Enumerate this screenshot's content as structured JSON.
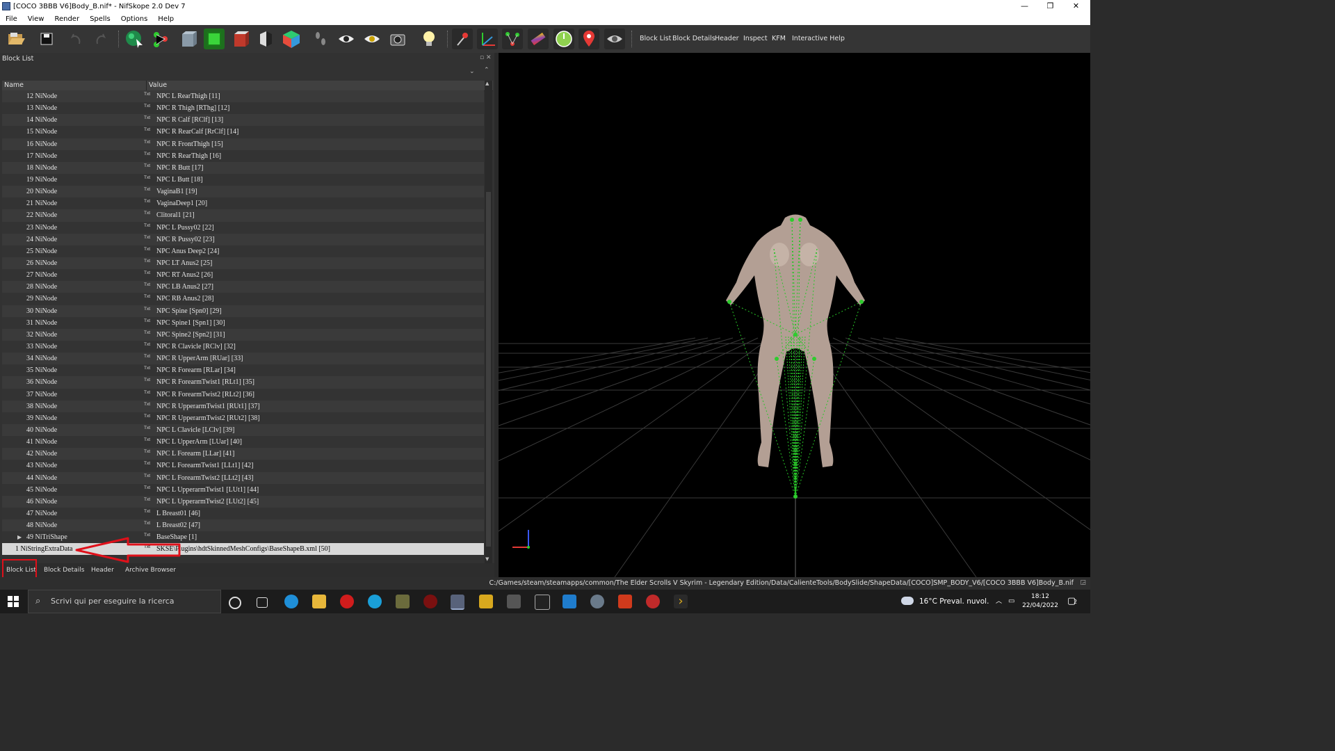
{
  "window": {
    "title": "[COCO 3BBB V6]Body_B.nif* - NifSkope 2.0 Dev 7",
    "controls": [
      "—",
      "❐",
      "✕"
    ]
  },
  "menu": [
    "File",
    "View",
    "Render",
    "Spells",
    "Options",
    "Help"
  ],
  "toolbar": {
    "icons": [
      "open-file",
      "save",
      "undo",
      "redo",
      "select",
      "node-tree",
      "box-wire",
      "box-green",
      "box-red",
      "box-shade",
      "cube-color",
      "footprints",
      "eye",
      "eye-cross",
      "screenshot",
      "lightbulb",
      "pin-red",
      "axes",
      "vertices",
      "gradient",
      "compass",
      "marker-red",
      "eye-toggle"
    ],
    "dock_links": [
      "Block List",
      "Block Details",
      "Header",
      "Inspect",
      "KFM",
      "Interactive Help"
    ]
  },
  "block_list": {
    "panel_title": "Block List",
    "columns": [
      "Name",
      "Value"
    ],
    "value_prefix": "Txt",
    "rows": [
      {
        "name": "12 NiNode",
        "value": "NPC L RearThigh [11]"
      },
      {
        "name": "13 NiNode",
        "value": "NPC R Thigh [RThg] [12]"
      },
      {
        "name": "14 NiNode",
        "value": "NPC R Calf [RClf] [13]"
      },
      {
        "name": "15 NiNode",
        "value": "NPC R RearCalf [RrClf] [14]"
      },
      {
        "name": "16 NiNode",
        "value": "NPC R FrontThigh [15]"
      },
      {
        "name": "17 NiNode",
        "value": "NPC R RearThigh [16]"
      },
      {
        "name": "18 NiNode",
        "value": "NPC R Butt [17]"
      },
      {
        "name": "19 NiNode",
        "value": "NPC L Butt [18]"
      },
      {
        "name": "20 NiNode",
        "value": "VaginaB1 [19]"
      },
      {
        "name": "21 NiNode",
        "value": "VaginaDeep1 [20]"
      },
      {
        "name": "22 NiNode",
        "value": "Clitoral1 [21]"
      },
      {
        "name": "23 NiNode",
        "value": "NPC L Pussy02 [22]"
      },
      {
        "name": "24 NiNode",
        "value": "NPC R Pussy02 [23]"
      },
      {
        "name": "25 NiNode",
        "value": "NPC Anus Deep2 [24]"
      },
      {
        "name": "26 NiNode",
        "value": "NPC LT Anus2 [25]"
      },
      {
        "name": "27 NiNode",
        "value": "NPC RT Anus2 [26]"
      },
      {
        "name": "28 NiNode",
        "value": "NPC LB Anus2 [27]"
      },
      {
        "name": "29 NiNode",
        "value": "NPC RB Anus2 [28]"
      },
      {
        "name": "30 NiNode",
        "value": "NPC Spine [Spn0] [29]"
      },
      {
        "name": "31 NiNode",
        "value": "NPC Spine1 [Spn1] [30]"
      },
      {
        "name": "32 NiNode",
        "value": "NPC Spine2 [Spn2] [31]"
      },
      {
        "name": "33 NiNode",
        "value": "NPC R Clavicle [RClv] [32]"
      },
      {
        "name": "34 NiNode",
        "value": "NPC R UpperArm [RUar] [33]"
      },
      {
        "name": "35 NiNode",
        "value": "NPC R Forearm [RLar] [34]"
      },
      {
        "name": "36 NiNode",
        "value": "NPC R ForearmTwist1 [RLt1] [35]"
      },
      {
        "name": "37 NiNode",
        "value": "NPC R ForearmTwist2 [RLt2] [36]"
      },
      {
        "name": "38 NiNode",
        "value": "NPC R UpperarmTwist1 [RUt1] [37]"
      },
      {
        "name": "39 NiNode",
        "value": "NPC R UpperarmTwist2 [RUt2] [38]"
      },
      {
        "name": "40 NiNode",
        "value": "NPC L Clavicle [LClv] [39]"
      },
      {
        "name": "41 NiNode",
        "value": "NPC L UpperArm [LUar] [40]"
      },
      {
        "name": "42 NiNode",
        "value": "NPC L Forearm [LLar] [41]"
      },
      {
        "name": "43 NiNode",
        "value": "NPC L ForearmTwist1 [LLt1] [42]"
      },
      {
        "name": "44 NiNode",
        "value": "NPC L ForearmTwist2 [LLt2] [43]"
      },
      {
        "name": "45 NiNode",
        "value": "NPC L UpperarmTwist1 [LUt1] [44]"
      },
      {
        "name": "46 NiNode",
        "value": "NPC L UpperarmTwist2 [LUt2] [45]"
      },
      {
        "name": "47 NiNode",
        "value": "L Breast01 [46]"
      },
      {
        "name": "48 NiNode",
        "value": "L Breast02 [47]"
      },
      {
        "name": "49 NiTriShape",
        "value": "BaseShape [1]",
        "expandable": true
      },
      {
        "name": "1 NiStringExtraData",
        "value": "SKSE\\Plugins\\hdtSkinnedMeshConfigs\\BaseShapeB.xml [50]",
        "selected": true
      }
    ]
  },
  "bottom_tabs": [
    "Block List",
    "Block Details",
    "Header",
    "Archive Browser"
  ],
  "annotation": {
    "color": "#e0101a"
  },
  "status_bar": {
    "path": "C:/Games/steam/steamapps/common/The Elder Scrolls V Skyrim - Legendary Edition/Data/CalienteTools/BodySlide/ShapeData/[COCO]SMP_BODY_V6/[COCO 3BBB V6]Body_B.nif"
  },
  "taskbar": {
    "search_placeholder": "Scrivi qui per eseguire la ricerca",
    "weather": "16°C  Preval. nuvol.",
    "time": "18:12",
    "date": "22/04/2022",
    "notification_count": "2"
  },
  "colors": {
    "accent_green": "#2ecc2e",
    "skeleton_green": "#27c627",
    "body_skin": "#b39f94"
  }
}
